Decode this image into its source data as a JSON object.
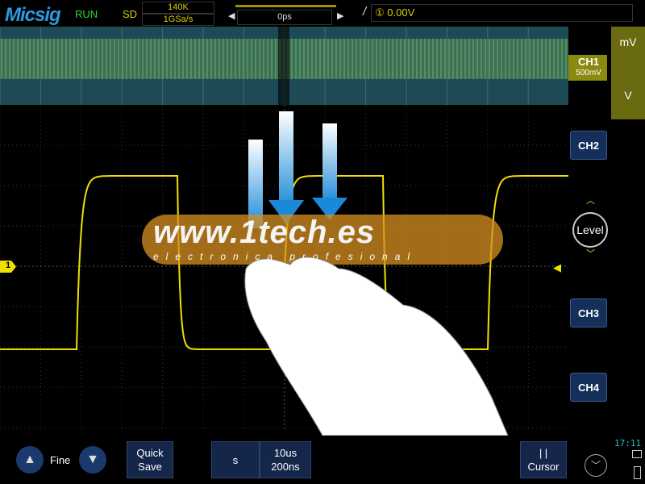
{
  "header": {
    "brand": "Micsig",
    "run_state": "RUN",
    "mode": "SD",
    "memory_depth": "140K",
    "sample_rate": "1GSa/s",
    "trigger_position": "0ps",
    "trigger_info": "① 0.00V",
    "trigger_slope_icon": "rising-edge-icon"
  },
  "right_panel": {
    "unit_top": "mV",
    "unit_bottom": "V",
    "ch1_label": "CH1",
    "ch1_scale": "500mV",
    "ch2": "CH2",
    "level": "Level",
    "ch3": "CH3",
    "ch4": "CH4"
  },
  "waveform": {
    "channel_marker": "1",
    "color": "#f0e000"
  },
  "watermark": {
    "main": "www.1tech.es",
    "sub": "electronica profesional"
  },
  "bottom": {
    "fine": "Fine",
    "quick_save": "Quick\nSave",
    "time_unit": "s",
    "timebase": "10us",
    "timebase_sub": "200ns",
    "cursor": "Cursor",
    "clock": "17:11"
  }
}
